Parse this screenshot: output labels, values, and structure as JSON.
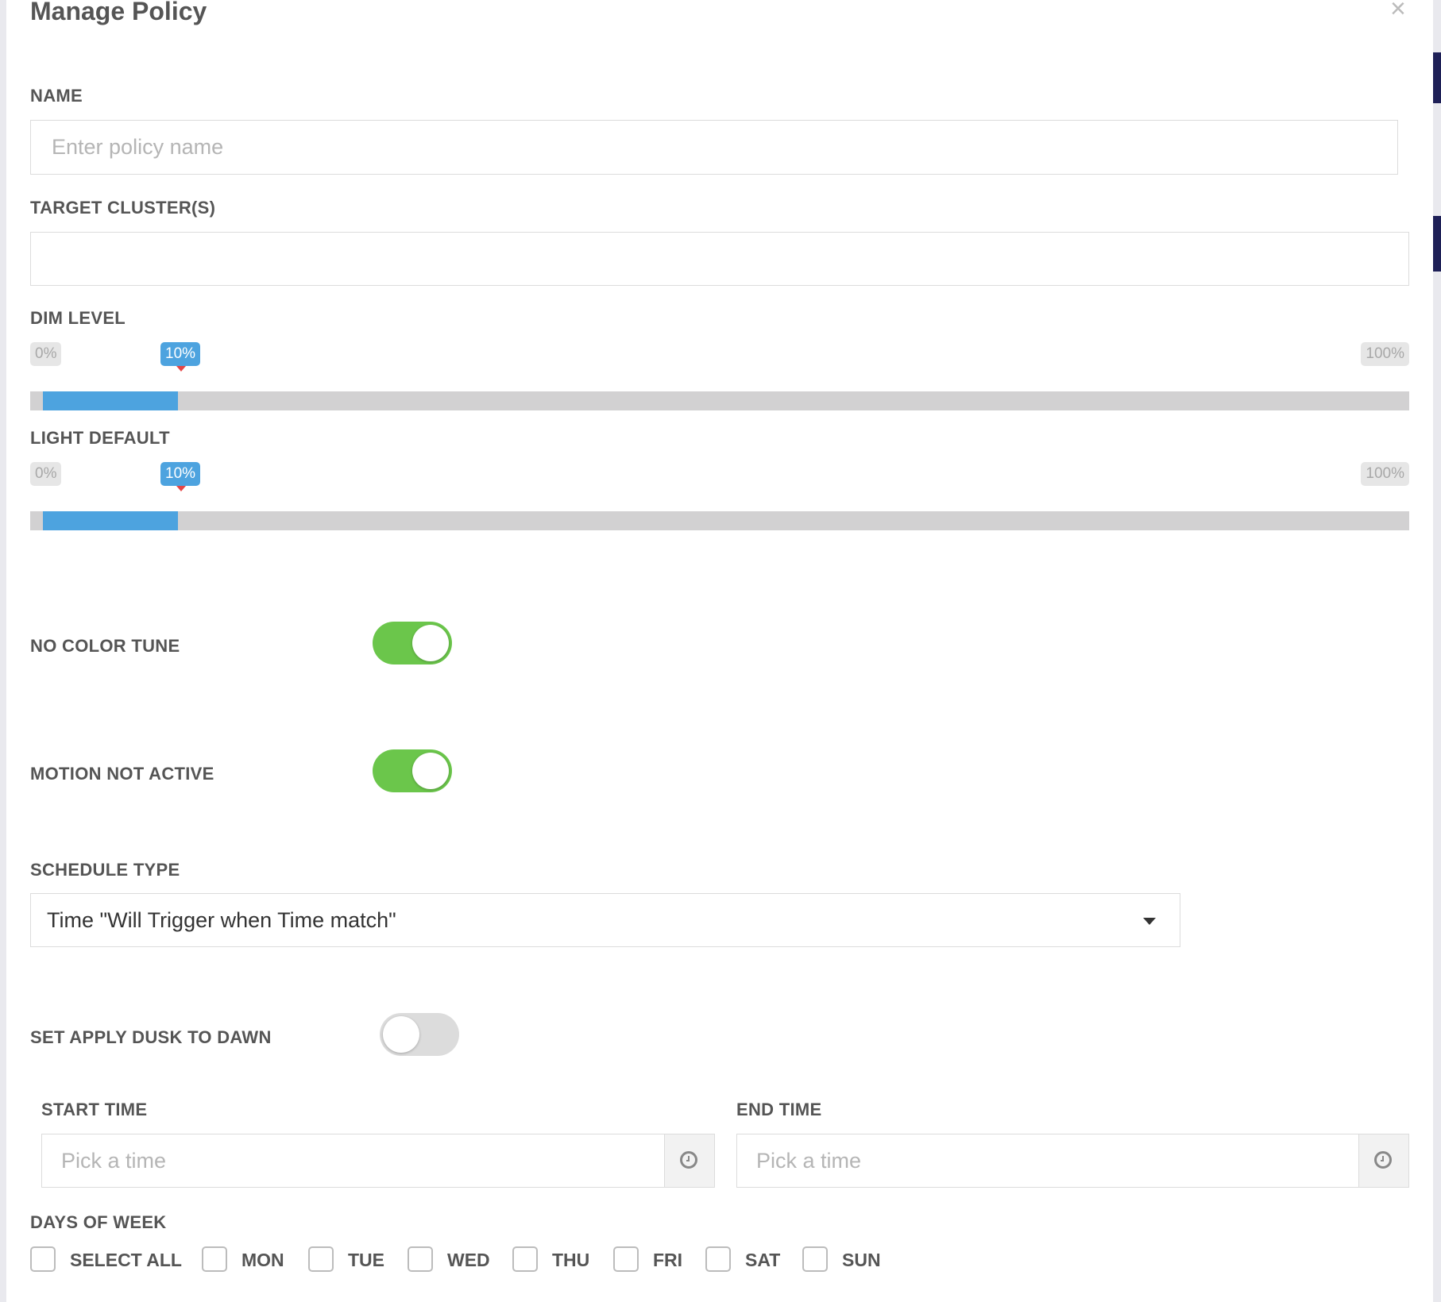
{
  "modal": {
    "title": "Manage Policy",
    "close_glyph": "×"
  },
  "name": {
    "label": "NAME",
    "placeholder": "Enter policy name",
    "value": ""
  },
  "target_clusters": {
    "label": "TARGET CLUSTER(S)",
    "value": ""
  },
  "dim_level": {
    "label": "DIM LEVEL",
    "min_label": "0%",
    "max_label": "100%",
    "current_label": "10%",
    "value_fraction": 0.1
  },
  "light_default": {
    "label": "LIGHT DEFAULT",
    "min_label": "0%",
    "max_label": "100%",
    "current_label": "10%",
    "value_fraction": 0.1
  },
  "no_color_tune": {
    "label": "NO COLOR TUNE",
    "on": true
  },
  "motion_not_active": {
    "label": "MOTION NOT ACTIVE",
    "on": true
  },
  "schedule_type": {
    "label": "SCHEDULE TYPE",
    "selected": "Time \"Will Trigger when Time match\""
  },
  "dusk_to_dawn": {
    "label": "SET APPLY DUSK TO DAWN",
    "on": false
  },
  "start_time": {
    "label": "START TIME",
    "placeholder": "Pick a time"
  },
  "end_time": {
    "label": "END TIME",
    "placeholder": "Pick a time"
  },
  "days_of_week": {
    "label": "DAYS OF WEEK",
    "options": [
      {
        "label": "SELECT ALL",
        "checked": false
      },
      {
        "label": "MON",
        "checked": false
      },
      {
        "label": "TUE",
        "checked": false
      },
      {
        "label": "WED",
        "checked": false
      },
      {
        "label": "THU",
        "checked": false
      },
      {
        "label": "FRI",
        "checked": false
      },
      {
        "label": "SAT",
        "checked": false
      },
      {
        "label": "SUN",
        "checked": false
      }
    ]
  },
  "colors": {
    "accent_blue": "#4da3df",
    "toggle_on": "#6bc64b",
    "toggle_off": "#dcdcdc",
    "pointer_red": "#e64545"
  }
}
